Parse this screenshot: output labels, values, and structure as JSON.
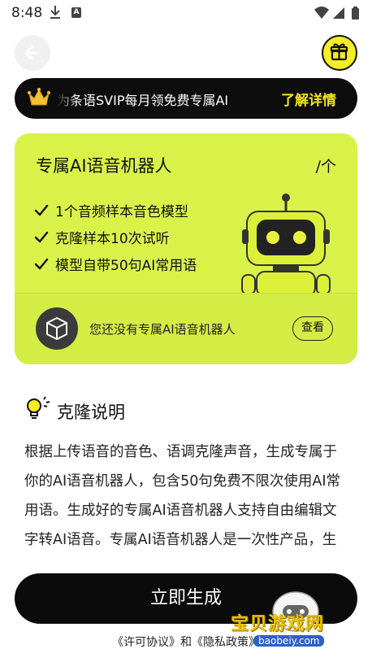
{
  "status_bar": {
    "time": "8:48",
    "icons": [
      "download-icon",
      "a-icon",
      "wifi-icon",
      "signal-icon",
      "battery-icon"
    ]
  },
  "header": {
    "back_icon": "arrow-left-icon",
    "gift_icon": "gift-icon"
  },
  "promo": {
    "text": "为条语SVIP每月领免费专属AI",
    "link": "了解详情",
    "colors": {
      "background": "#0d0d0d",
      "link": "#f1e51a"
    }
  },
  "plan_card": {
    "title": "专属AI语音机器人",
    "unit": "/个",
    "features": [
      "1个音频样本音色模型",
      "克隆样本10次试听",
      "模型自带50句AI常用语"
    ],
    "empty_text": "您还没有专属AI语音机器人",
    "view_button": "查看",
    "colors": {
      "background": "#d9f24a"
    }
  },
  "explanation": {
    "title": "克隆说明",
    "body": "根据上传语音的音色、语调克隆声音，生成专属于你的AI语音机器人，包含50句免费不限次使用AI常用语。生成好的专属AI语音机器人支持自由编辑文字转AI语音。专属AI语音机器人是一次性产品，生成AI语音机器人"
  },
  "footer": {
    "generate_button": "立即生成",
    "terms": "《许可协议》和《隐私政策》"
  },
  "watermark": {
    "text": "宝贝游戏网",
    "url": "baobeiy.com"
  }
}
